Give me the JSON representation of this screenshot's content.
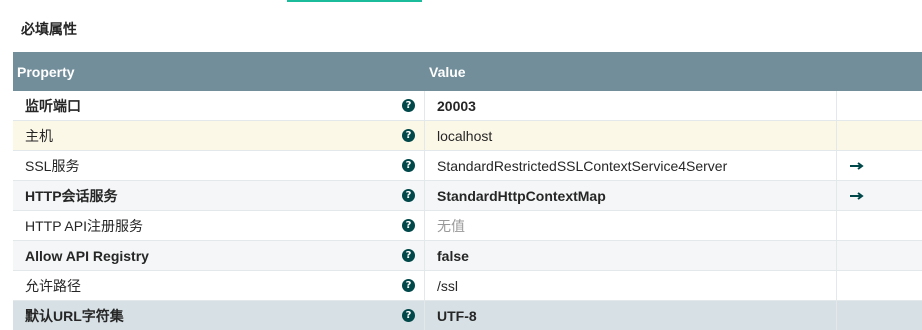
{
  "section": {
    "title": "必填属性"
  },
  "table": {
    "headers": {
      "property": "Property",
      "value": "Value"
    },
    "rows": [
      {
        "property": "监听端口",
        "value": "20003",
        "required": true,
        "has_arrow": false,
        "value_empty": false,
        "style": "alt-white"
      },
      {
        "property": "主机",
        "value": "localhost",
        "required": false,
        "has_arrow": false,
        "value_empty": false,
        "style": "highlight"
      },
      {
        "property": "SSL服务",
        "value": "StandardRestrictedSSLContextService4Server",
        "required": false,
        "has_arrow": true,
        "value_empty": false,
        "style": "alt-white"
      },
      {
        "property": "HTTP会话服务",
        "value": "StandardHttpContextMap",
        "required": true,
        "has_arrow": true,
        "value_empty": false,
        "style": "alt"
      },
      {
        "property": "HTTP API注册服务",
        "value": "无值",
        "required": false,
        "has_arrow": false,
        "value_empty": true,
        "style": "alt-white"
      },
      {
        "property": "Allow API Registry",
        "value": "false",
        "required": true,
        "has_arrow": false,
        "value_empty": false,
        "style": "alt"
      },
      {
        "property": "允许路径",
        "value": "/ssl",
        "required": false,
        "has_arrow": false,
        "value_empty": false,
        "style": "alt-white"
      },
      {
        "property": "默认URL字符集",
        "value": "UTF-8",
        "required": true,
        "has_arrow": false,
        "value_empty": false,
        "style": "selected"
      }
    ]
  },
  "icons": {
    "help": "help-icon",
    "goto": "arrow-right-icon"
  },
  "colors": {
    "header_bg": "#728e9b",
    "accent": "#1abc9c",
    "icon": "#004849"
  }
}
